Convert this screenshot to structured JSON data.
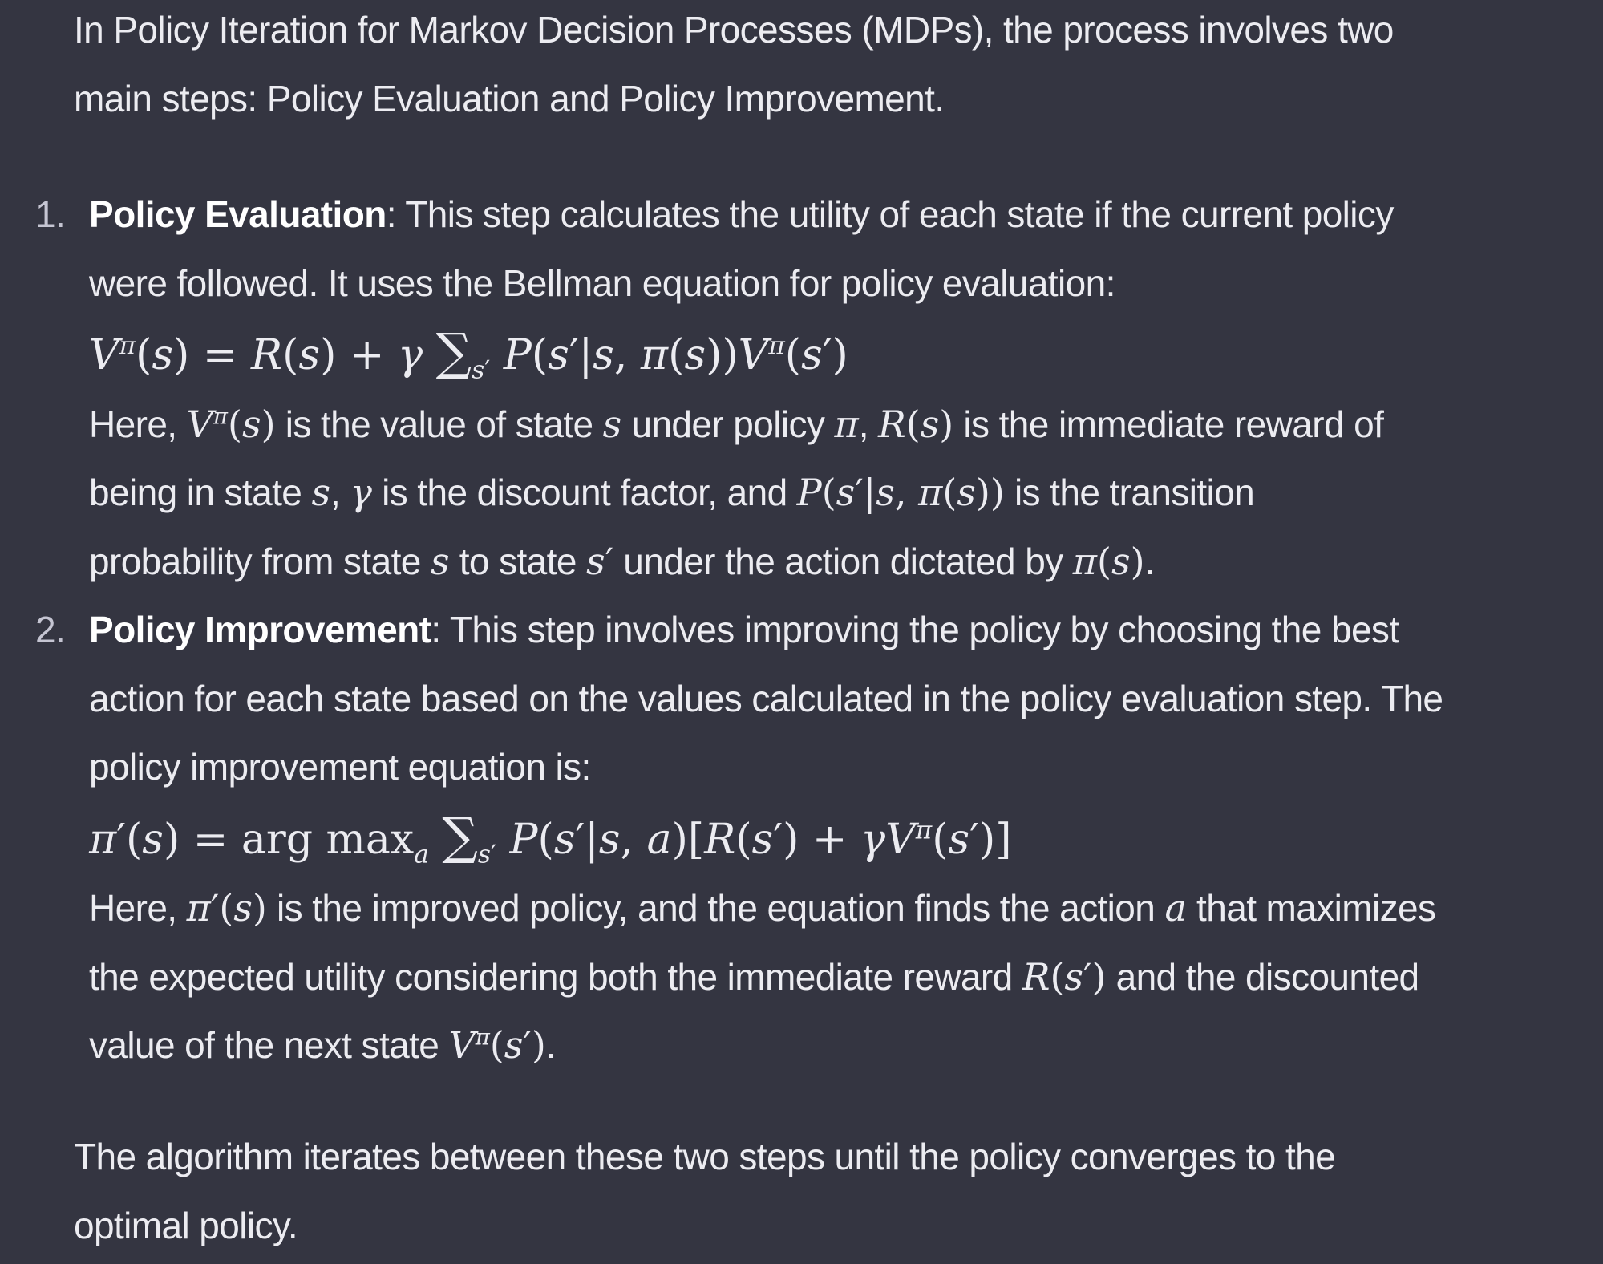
{
  "intro": {
    "line1": "In Policy Iteration for Markov Decision Processes (MDPs), the process involves two",
    "line2": "main steps: Policy Evaluation and Policy Improvement."
  },
  "steps": [
    {
      "number": "1.",
      "title": "Policy Evaluation",
      "lines": [
        "This step calculates the utility of each state if the current policy",
        "were followed. It uses the Bellman equation for policy evaluation:"
      ],
      "equation": "Vπ(s) = R(s) + γ Σs' P(s'|s, π(s))Vπ(s')",
      "explanation": [
        "Here, Vπ(s) is the value of state s under policy π, R(s) is the immediate reward of",
        "being in state s, γ is the discount factor, and P(s'|s, π(s)) is the transition",
        "probability from state s to state s' under the action dictated by π(s)."
      ]
    },
    {
      "number": "2.",
      "title": "Policy Improvement",
      "lines": [
        "This step involves improving the policy by choosing the best",
        "action for each state based on the values calculated in the policy evaluation step. The",
        "policy improvement equation is:"
      ],
      "equation": "π'(s) = arg maxa Σs' P(s'|s, a)[R(s') + γVπ(s')]",
      "explanation": [
        "Here, π'(s) is the improved policy, and the equation finds the action a that maximizes",
        "the expected utility considering both the immediate reward R(s') and the discounted",
        "value of the next state Vπ(s')."
      ]
    }
  ],
  "outro": {
    "line1": "The algorithm iterates between these two steps until the policy converges to the",
    "line2": "optimal policy."
  }
}
